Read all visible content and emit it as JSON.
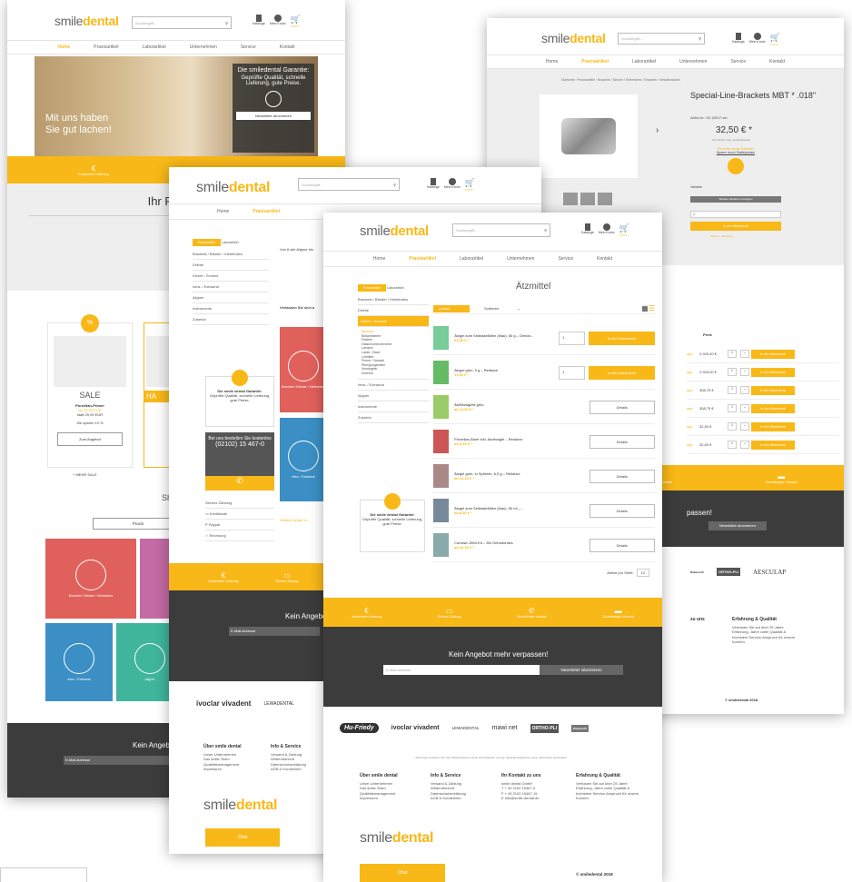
{
  "brand": {
    "name_main": "smile",
    "name_accent": "dental",
    "reg": "®"
  },
  "header": {
    "search_placeholder": "Suchbegriff...",
    "catalogs_label": "Kataloge",
    "account_label": "Mein Konto",
    "cart_label": "0,00 € *"
  },
  "nav": [
    "Home",
    "Praxisartikel",
    "Laborartikel",
    "Unternehmen",
    "Service",
    "Kontakt"
  ],
  "home": {
    "hero_line1": "Mit uns haben",
    "hero_line2": "Sie gut lachen!",
    "guarantee_title": "Die smiledental Garantie:",
    "guarantee_text": "Geprüfte Qualität, schnelle Lieferung, gute Preise.",
    "newsletter_btn": "Newsletter abonnieren",
    "welcome_title": "Ihr Fachhändler für ki",
    "welcome_q": "Womit dürfen w",
    "sale_label": "SALE",
    "sale_product": "Porzellan-Primer",
    "sale_price_new": "ab 19,99 EUR",
    "sale_price_old": "statt 29,99 EUR",
    "sale_saving": "Sie sparen 10 %",
    "sale_btn": "Zum Angebot",
    "sale_more": "+ MEHR SALE",
    "ha_label": "HA",
    "shop_title": "Sho",
    "praxis_btn": "Praxis",
    "tile1": "Brackets / Bänder / Klebetubes",
    "tile2": "Intra- / Extraoral",
    "tile3": "Aligner",
    "newsletter_title": "Kein Angeb",
    "email_placeholder": "E-Mail-Adresse"
  },
  "category_page": {
    "tab_praxis": "Praxisartikel",
    "tab_labor": "Laborartikel",
    "sidebar": [
      "Brackets / Bänder / Klebetubes",
      "Drähte",
      "Kleber / Zement",
      "Intra- / Extraoral",
      "Aligner",
      "Instrumente",
      "Zubehör"
    ],
    "intro_snippet": "Von A wie Aligner bis",
    "intro_q": "Verlassen Sie sich a",
    "guarantee_title": "Die smile dental Garantie:",
    "guarantee_text": "Geprüfte Qualität, schnelle Lieferung, gute Preise.",
    "order_line": "Bei uns bestellen Sie kostenlos",
    "phone": "(02102) 15 467-0",
    "payment_title": "Sichere Zahlung",
    "payments": [
      "Kreditkarte",
      "Paypal",
      "Rechnung"
    ],
    "tile1": "Brackets / Bänder / Klebetubes",
    "tile2": "Intra- / Extraoral",
    "more_link": "Weitere Artikel in ..."
  },
  "product_page": {
    "breadcrumb": "Startseite  ›  Praxisartikel  ›  Brackets / Bänder / Klebetubes  ›  Brackets  ›  Metallbrackets",
    "title": "Special-Line-Brackets MBT * .018\"",
    "sku": "Artikel-Nr.: SD-1050-P-set",
    "price": "32,50 € *",
    "price_note": "inkl. MwSt. zzgl. Versandkosten",
    "guarantee_title": "Die smile dental Garantie:",
    "guarantee_text": "Sparen durch Staffelpreise!",
    "variant_label": "Variante",
    "variant_btn": "Weitere Varianten anzeigen",
    "cart_btn": "In den Warenkorb",
    "wishlist": "Merken  ·  Bewerten",
    "price_header": "Preis",
    "price_rows": [
      "2.925,00 €",
      "2.925,00 €",
      "308,75 €",
      "308,75 €",
      "32,50 €",
      "32,50 €"
    ],
    "row_prefix": "age",
    "qty": "1",
    "row_btn": "In den Warenkorb",
    "newsletter_title": "passen!",
    "newsletter_btn": "Newsletter abonnieren",
    "footer_col_title": "Erfahrung & Qualität",
    "footer_col_text": "Vertrauen Sie auf über 25 Jahre Erfahrung, Jahre voller Qualität & höchstem Service-Anspruch für unsere Kunden.",
    "contact_title": "zu uns",
    "copyright": "© smiledental 2018",
    "brand_aesculap": "AESCULAP"
  },
  "atzmittel": {
    "title": "Ätzmittel",
    "sidebar_top": [
      "Brackets / Bänder / Klebetubes",
      "Drähte"
    ],
    "sidebar_active": "Kleber / Zement",
    "sidebar_sub": [
      "Ätzmittel",
      "Bracketkleber",
      "Fissiten",
      "Glasionomerzemente",
      "Lampen",
      "Lacke, Glaze",
      "Lötmittel",
      "Primer / Sealant",
      "Reinigungsmittel",
      "Versiegeler",
      "Zubehör"
    ],
    "sidebar_bottom": [
      "Intra- / Extraoral",
      "Aligner",
      "Instrumente",
      "Zubehör"
    ],
    "sort_pill": "◂ Marke",
    "sort_label": "Sortieren",
    "products": [
      {
        "name": "Ätzgel zum Selbstabfüllen (blau), 50 g – Dental...",
        "price": "61,50 € *",
        "action": "cart"
      },
      {
        "name": "Ätzgel grün, 9 g – Reliance",
        "price": "11,60 € *",
        "action": "cart"
      },
      {
        "name": "Ätzflüssigkeit grün",
        "price": "ab 11,90 € *",
        "action": "details"
      },
      {
        "name": "Porzellan-Ätzer inkl. Abdeckgel – Reliance",
        "price": "ab 8,90 € *",
        "action": "details"
      },
      {
        "name": "Ätzgel grün, in Spritzen, 6,5 g – Reliance",
        "price": "ab 13,20 € *",
        "action": "details"
      },
      {
        "name": "Ätzgel zum Selbstabfüllen (blau), 50 ml –...",
        "price": "ab 8,50 € *",
        "action": "details"
      },
      {
        "name": "Concise-1960-Kit – 3M Orthodontics",
        "price": "ab 22,20 € *",
        "action": "details"
      }
    ],
    "qty": "1",
    "cart_btn": "In den Warenkorb",
    "details_btn": "Details",
    "per_page_label": "Artikel pro Seite:",
    "per_page_value": "12",
    "guarantee_title": "Die smile dental Garantie:",
    "guarantee_text": "Geprüfte Qualität, schnelle Lieferung, gute Preise."
  },
  "usp_bar": [
    "Kostenfreie Lieferung",
    "Sichere Zahlung",
    "Persönlicher Kontakt",
    "Zuverlässiger Versand"
  ],
  "footer": {
    "newsletter_title": "Kein Angebot mehr verpassen!",
    "email_placeholder": "E-Mail-Adresse",
    "newsletter_btn": "Newsletter abonnieren",
    "brands": [
      "Hu-Friedy",
      "ivoclar vivadent",
      "LEWADENTAL",
      "mawi net",
      "ORTHO-PLI",
      "Rabenorth"
    ],
    "disclaimer": "* Alle Preise verstehen sich zzgl. Mehrwertsteuer und ab Versandkosten und ggf. Nachnahmegebühren, wenn nicht anders beschrieben",
    "col1_title": "Über smile dental",
    "col1": [
      "Unser Unternehmen",
      "Das smile-Team",
      "Qualitätsmanagement",
      "Impressum"
    ],
    "col2_title": "Info & Service",
    "col2": [
      "Versand & Zahlung",
      "Widerrufsrecht",
      "Datenschutzerklärung",
      "AGB & Kundeninfo"
    ],
    "col3_title": "Ihr Kontakt zu uns",
    "col3": [
      "smile dental GmbH",
      "T + 49 2102 15467-0",
      "F + 49 2102 15467-15",
      "E info@smile-dental.de"
    ],
    "col4_title": "Erfahrung & Qualität",
    "col4": "Vertrauen Sie auf über 25 Jahre Erfahrung, Jahre voller Qualität & höchstem Service-Anspruch für unsere Kunden.",
    "chat_label": "Chat",
    "copyright": "© smiledental 2018"
  },
  "colors": {
    "accent": "#f8b817",
    "dark": "#3c3c3c",
    "red": "#e0605b",
    "blue": "#3b8fc4",
    "green": "#3fb59c",
    "purple": "#c46aa4"
  }
}
